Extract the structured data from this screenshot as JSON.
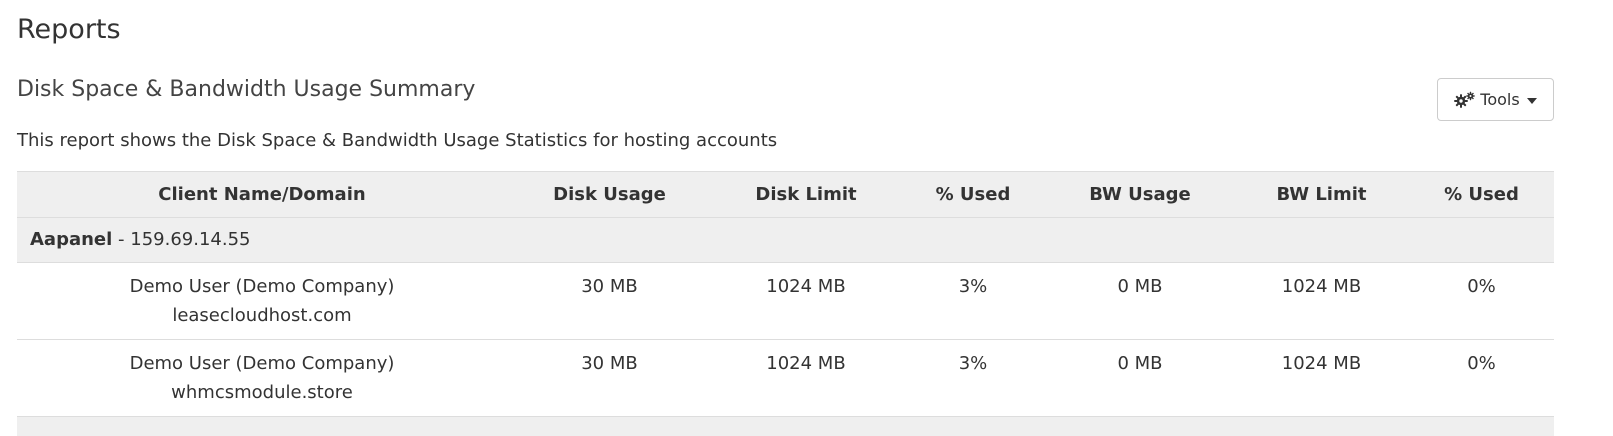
{
  "page": {
    "title": "Reports"
  },
  "report": {
    "title": "Disk Space & Bandwidth Usage Summary",
    "description": "This report shows the Disk Space & Bandwidth Usage Statistics for hosting accounts",
    "tools_label": "Tools",
    "tools_icon": "gears-icon",
    "columns": {
      "client": "Client Name/Domain",
      "disk_usage": "Disk Usage",
      "disk_limit": "Disk Limit",
      "disk_pct": "% Used",
      "bw_usage": "BW Usage",
      "bw_limit": "BW Limit",
      "bw_pct": "% Used"
    },
    "groups": [
      {
        "server_name": "Aapanel",
        "server_separator": " - ",
        "server_ip": "159.69.14.55",
        "rows": [
          {
            "client": "Demo User (Demo Company)",
            "domain": "leasecloudhost.com",
            "disk_usage": "30 MB",
            "disk_limit": "1024 MB",
            "disk_pct": "3%",
            "bw_usage": "0 MB",
            "bw_limit": "1024 MB",
            "bw_pct": "0%"
          },
          {
            "client": "Demo User (Demo Company)",
            "domain": "whmcsmodule.store",
            "disk_usage": "30 MB",
            "disk_limit": "1024 MB",
            "disk_pct": "3%",
            "bw_usage": "0 MB",
            "bw_limit": "1024 MB",
            "bw_pct": "0%"
          }
        ]
      }
    ]
  },
  "colors": {
    "header_bg": "#efefef",
    "border": "#dddddd",
    "text": "#333333"
  }
}
